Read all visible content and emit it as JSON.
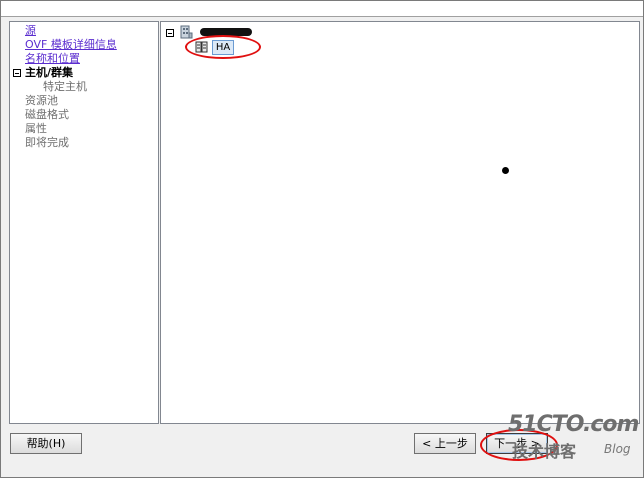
{
  "wizard": {
    "steps": [
      {
        "label": "源",
        "state": "done"
      },
      {
        "label": "OVF 模板详细信息",
        "state": "done"
      },
      {
        "label": "名称和位置",
        "state": "done"
      },
      {
        "label": "主机/群集",
        "state": "current"
      },
      {
        "label": "特定主机",
        "state": "sub"
      },
      {
        "label": "资源池",
        "state": "pending"
      },
      {
        "label": "磁盘格式",
        "state": "pending"
      },
      {
        "label": "属性",
        "state": "pending"
      },
      {
        "label": "即将完成",
        "state": "pending"
      }
    ]
  },
  "tree": {
    "cluster_label": "HA",
    "root_icon": "datacenter-icon",
    "cluster_icon": "cluster-icon"
  },
  "buttons": {
    "help": "帮助(H)",
    "back": "< 上一步",
    "next": "下一步 >"
  },
  "watermark": {
    "main": "51CTO.com",
    "sub": "技术博客",
    "blog": "Blog"
  },
  "colors": {
    "link": "#5a2dcf",
    "annotation": "#e01010",
    "selection": "#dce9f7"
  }
}
